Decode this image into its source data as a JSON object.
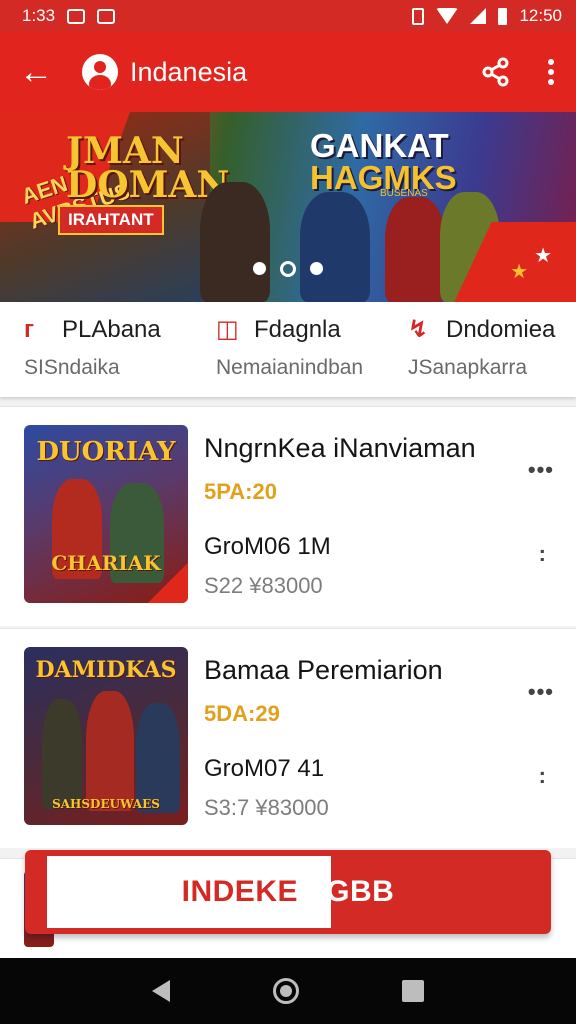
{
  "status_bar": {
    "time": "1:33",
    "right_time": "12:50"
  },
  "app_bar": {
    "title": "Indanesia"
  },
  "banner": {
    "left_title": "JMAN\nDOMAN",
    "left_tag": "AEN\nAVRSTUS",
    "left_badge": "IRAHTANT",
    "right_title_line1": "GANKAT",
    "right_title_line2": "HAGMKS",
    "right_small": "BUSENAS",
    "slides": 3,
    "active_slide": 2
  },
  "categories": [
    {
      "icon": "flame-icon",
      "label": "PLAbana",
      "sub": "SISndaika"
    },
    {
      "icon": "chat-icon",
      "label": "Fdagnla",
      "sub": "Nemaianindban"
    },
    {
      "icon": "rocket-icon",
      "label": "Dndomiea",
      "sub": "JSanapkarra"
    }
  ],
  "games": [
    {
      "name": "NngrnKea iNanviaman",
      "rating": "5PA:20",
      "size": "GroM06 1M",
      "price": "S22 ¥83000",
      "thumb_title": "DUORIAY",
      "thumb_sub": "CHARIAK",
      "thumb_colors": [
        "#2e4aa0",
        "#8a1d12"
      ]
    },
    {
      "name": "Bamaa Peremiarion",
      "rating": "5DA:29",
      "size": "GroM07 41",
      "price": "S3:7 ¥83000",
      "thumb_title": "DAMIDKAS",
      "thumb_sub": "SAHSDEUWAES",
      "thumb_colors": [
        "#2b2f60",
        "#7a1e1e"
      ]
    }
  ],
  "cta": {
    "label_a": "INDEKE",
    "label_b": "AGBB"
  }
}
